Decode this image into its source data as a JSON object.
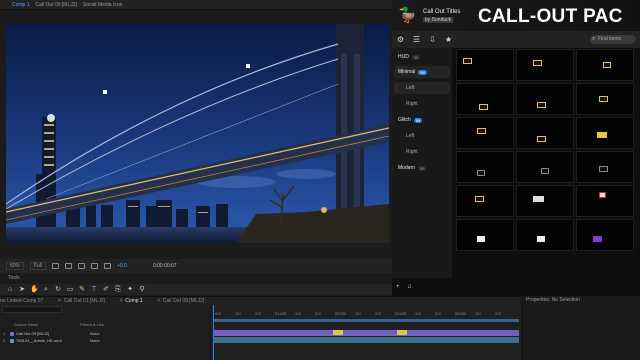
{
  "comp_tabs": [
    "Comp 1",
    "Call Out 09 [MLJ2]",
    "Social Media Icon"
  ],
  "viewer_bar": {
    "zoom": "50%",
    "resolution": "Full",
    "exposure": "+0.0",
    "timecode": "0:00:00:07"
  },
  "tools_label": "Tools",
  "tools": [
    "⌂",
    "➤",
    "✋",
    "⌕",
    "↻",
    "▭",
    "✎",
    "T",
    "✐",
    "⎘",
    "✦",
    "⚲"
  ],
  "timeline": {
    "tabs": [
      {
        "label": "no Linked Comp 07",
        "active": false
      },
      {
        "label": "Call Out 01 [MLJ2]",
        "active": false
      },
      {
        "label": "Comp 1",
        "active": true
      },
      {
        "label": "Call Out 09 [MLJ2]",
        "active": false
      }
    ],
    "properties_label": "Properties: No Selection",
    "col_source": "Source Name",
    "col_parent": "Parent & Link",
    "rows": [
      {
        "num": "1",
        "name": "Call Out 09 [MLJ2]",
        "parent": "None",
        "color": "#7f6ad6"
      },
      {
        "num": "2",
        "name": "750124__Article_HD.mp4",
        "parent": "None",
        "color": "#4fa3d1"
      }
    ],
    "ruler": [
      "00f",
      "10f",
      "20f",
      "01:00f",
      "10f",
      "20f",
      "02:00f",
      "10f",
      "20f",
      "03:00f",
      "10f",
      "20f",
      "04:00f",
      "10f",
      "20f"
    ]
  },
  "plugin": {
    "title": "Call Out Titles",
    "author": "by Sonduck",
    "banner": "CALL-OUT PAC",
    "search_placeholder": "Find items",
    "categories": [
      {
        "label": "HUD",
        "count": "99",
        "type": "main",
        "active": false
      },
      {
        "label": "Minimal",
        "count": "99",
        "type": "main",
        "active": true
      },
      {
        "label": "Left",
        "count": "",
        "type": "sub"
      },
      {
        "label": "Right",
        "count": "",
        "type": "sub"
      },
      {
        "label": "Glitch",
        "count": "99",
        "type": "main",
        "active": true
      },
      {
        "label": "Left",
        "count": "",
        "type": "sub"
      },
      {
        "label": "Right",
        "count": "",
        "type": "sub"
      },
      {
        "label": "Modern",
        "count": "99",
        "type": "main",
        "active": false
      }
    ]
  },
  "colors": {
    "accent": "#4aa8ff",
    "callout_yellow": "#e8c43a",
    "night_sky": "#0d1f4a",
    "bridge_lights": "#f2d37a"
  }
}
